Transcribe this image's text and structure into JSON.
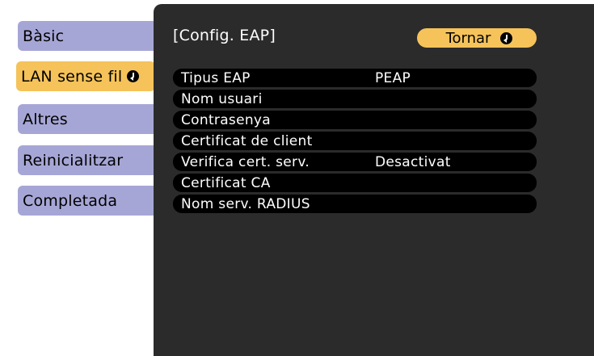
{
  "sidebar": {
    "items": [
      {
        "label": "Bàsic",
        "active": false
      },
      {
        "label": "LAN sense fil",
        "active": true
      },
      {
        "label": "Altres",
        "active": false
      },
      {
        "label": "Reinicialitzar",
        "active": false
      },
      {
        "label": "Completada",
        "active": false
      }
    ]
  },
  "panel": {
    "title": "[Config. EAP]",
    "back_label": "Tornar"
  },
  "settings": [
    {
      "label": "Tipus EAP",
      "value": "PEAP"
    },
    {
      "label": "Nom usuari",
      "value": ""
    },
    {
      "label": "Contrasenya",
      "value": ""
    },
    {
      "label": "Certificat de client",
      "value": ""
    },
    {
      "label": "Verifica cert. serv.",
      "value": "Desactivat"
    },
    {
      "label": "Certificat CA",
      "value": ""
    },
    {
      "label": "Nom serv. RADIUS",
      "value": ""
    }
  ],
  "colors": {
    "menu_inactive": "#a6a6d6",
    "menu_active": "#f5c35a",
    "panel_bg": "#2b2b2b",
    "row_bg": "#000000"
  },
  "icons": {
    "enter": "enter-icon"
  }
}
